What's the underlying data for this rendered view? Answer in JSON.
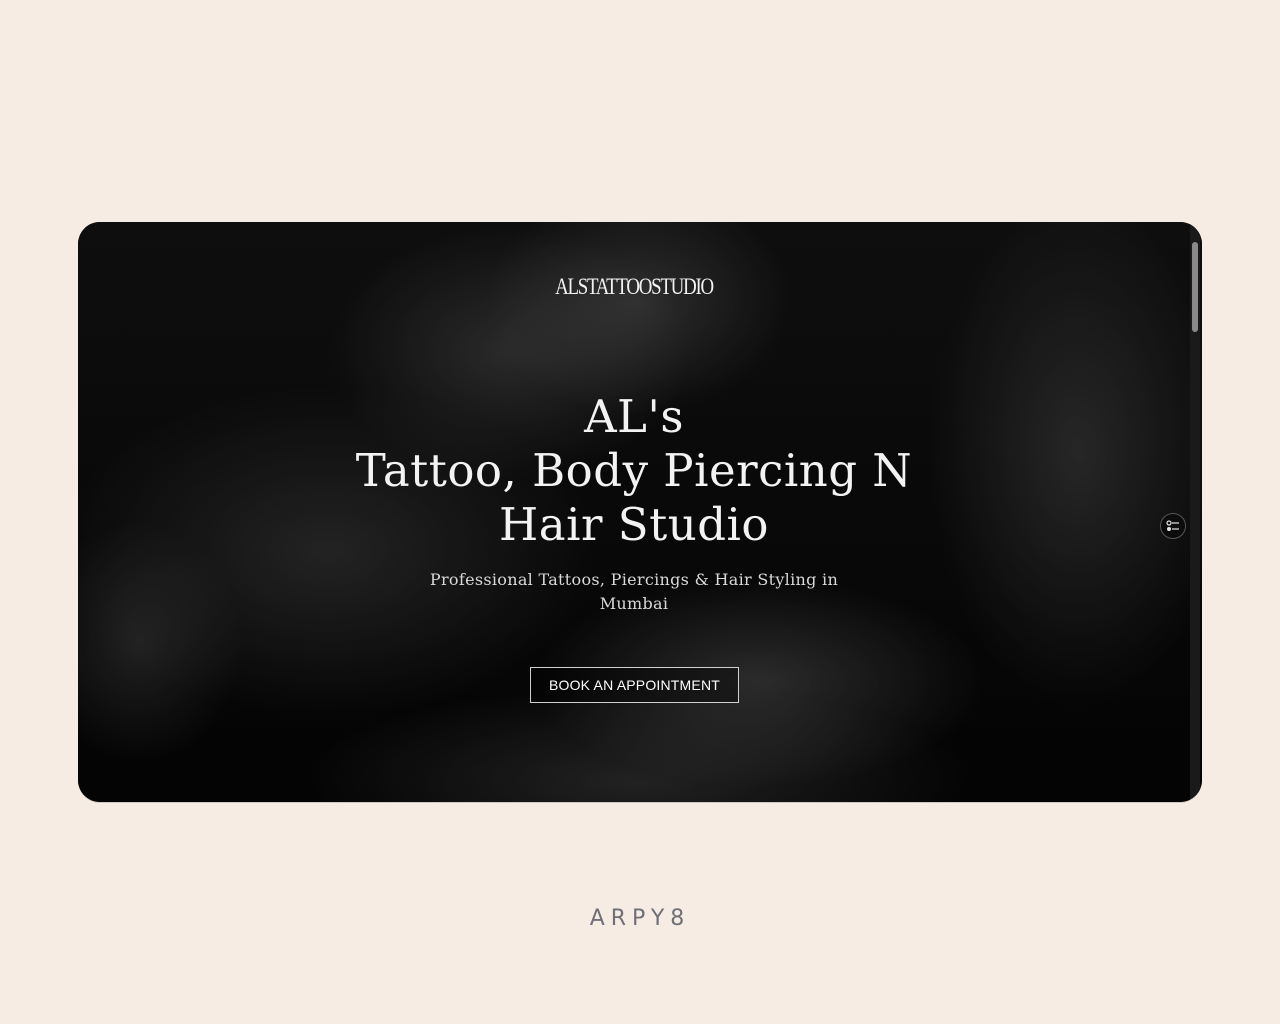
{
  "site": {
    "logo_text": "ALSTATTOOSTUDIO"
  },
  "hero": {
    "title_line1": "AL's",
    "title_line2": "Tattoo, Body Piercing N",
    "title_line3": "Hair Studio",
    "subtitle": "Professional Tattoos, Piercings & Hair Styling in Mumbai",
    "cta_label": "BOOK AN APPOINTMENT"
  },
  "widget": {
    "icon": "settings-toggle-icon"
  },
  "footer": {
    "brand": "ARPY8"
  },
  "colors": {
    "page_background": "#f6ece4",
    "frame_background": "#080808",
    "brand_text": "#6f6f78"
  }
}
